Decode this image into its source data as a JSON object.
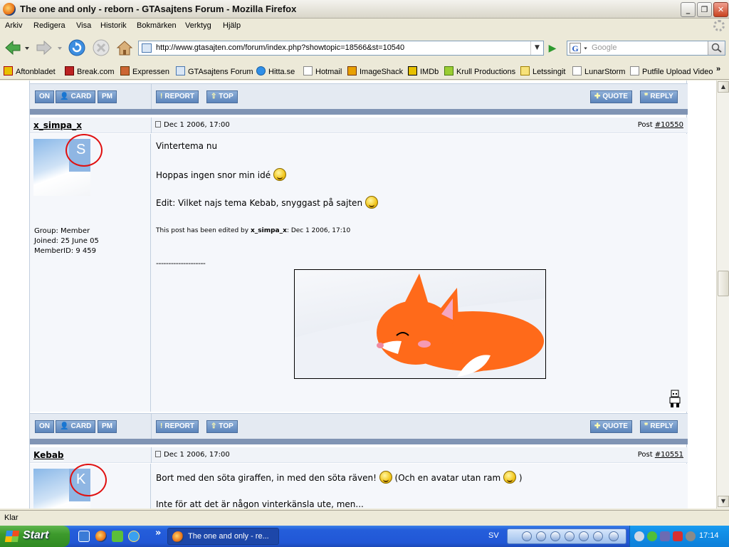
{
  "window": {
    "title": "The one and only - reborn - GTAsajtens Forum - Mozilla Firefox",
    "buttons": [
      "_",
      "❐",
      "✕"
    ]
  },
  "menu": [
    "Arkiv",
    "Redigera",
    "Visa",
    "Historik",
    "Bokmärken",
    "Verktyg",
    "Hjälp"
  ],
  "nav": {
    "url": "http://www.gtasajten.com/forum/index.php?showtopic=18566&st=10540",
    "search_placeholder": "Google",
    "search_engine_letter": "G"
  },
  "bookmarks": [
    "Aftonbladet",
    "Break.com",
    "Expressen",
    "GTAsajtens Forum",
    "Hitta.se",
    "Hotmail",
    "ImageShack",
    "IMDb",
    "Krull Productions",
    "Letssingit",
    "LunarStorm",
    "Putfile Upload Video"
  ],
  "bookmarks_more": "»",
  "buttons": {
    "on": "ON",
    "card": "CARD",
    "pm": "PM",
    "report": "REPORT",
    "top": "TOP",
    "quote": "QUOTE",
    "reply": "REPLY"
  },
  "posts": [
    {
      "user": "x_simpa_x",
      "avatar_letter": "S",
      "date": "Dec 1 2006, 17:00",
      "post_label": "Post ",
      "post_num": "#10550",
      "group": "Group: Member",
      "joined": "Joined: 25 June 05",
      "member_id": "MemberID: 9 459",
      "lines": [
        "Vintertema nu",
        "Hoppas ingen snor min idé",
        "Edit: Vilket najs tema Kebab, snyggast på sajten"
      ],
      "edit_prefix": "This post has been edited by ",
      "edit_user": "x_simpa_x",
      "edit_suffix": ": Dec 1 2006, 17:10",
      "sig_dashes": "--------------------"
    },
    {
      "user": "Kebab",
      "avatar_letter": "K",
      "date": "Dec 1 2006, 17:00",
      "post_label": "Post ",
      "post_num": "#10551",
      "line1a": "Bort med den söta giraffen, in med den söta räven!",
      "line1b": "(Och en avatar utan ram",
      "line1c": ")",
      "line2": "Inte för att det är någon vinterkänsla ute, men..."
    }
  ],
  "status": "Klar",
  "taskbar": {
    "start": "Start",
    "task": "The one and only - re...",
    "lang": "SV",
    "clock": "17:14",
    "more": "»"
  }
}
